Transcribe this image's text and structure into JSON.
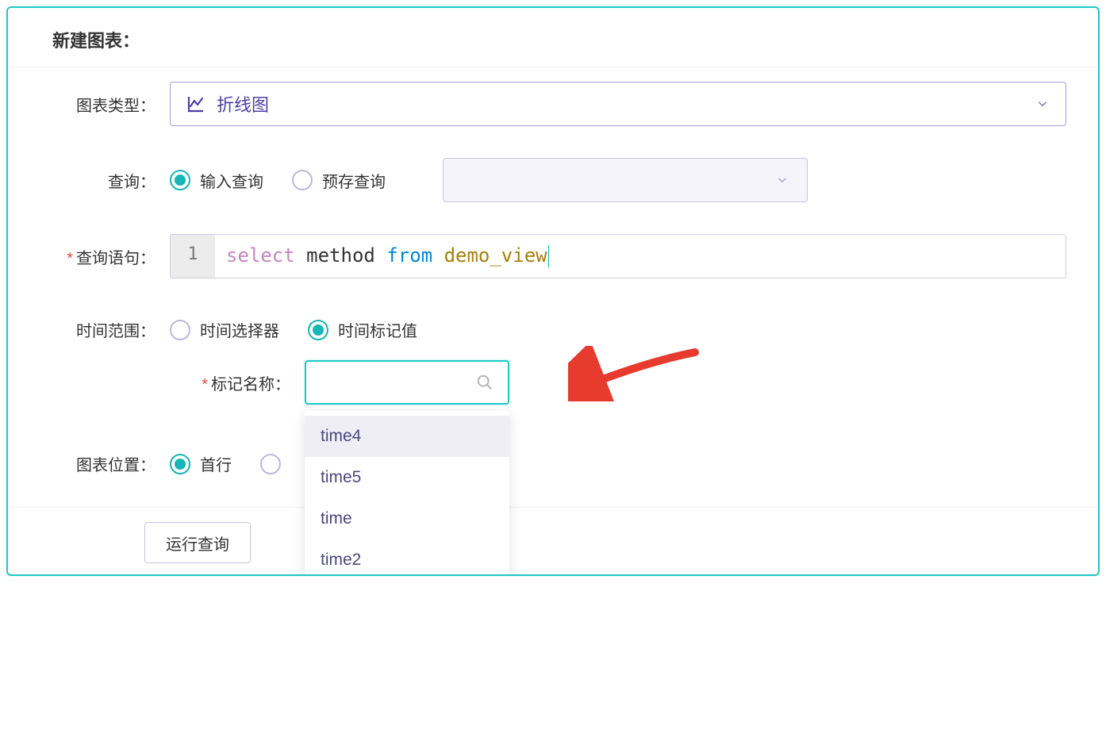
{
  "panel": {
    "title": "新建图表："
  },
  "chart_type": {
    "label": "图表类型：",
    "selected": "折线图"
  },
  "query": {
    "label": "查询：",
    "input_option": "输入查询",
    "preset_option": "预存查询"
  },
  "sql": {
    "label": "查询语句：",
    "line_no": "1",
    "kw_select": "select",
    "ident_method": "method",
    "kw_from": "from",
    "ident_table": "demo_view"
  },
  "time_range": {
    "label": "时间范围：",
    "picker_option": "时间选择器",
    "marker_option": "时间标记值"
  },
  "marker": {
    "label": "标记名称：",
    "options": [
      "time4",
      "time5",
      "time",
      "time2"
    ]
  },
  "position": {
    "label": "图表位置：",
    "first_row": "首行"
  },
  "footer": {
    "run_query": "运行查询"
  }
}
